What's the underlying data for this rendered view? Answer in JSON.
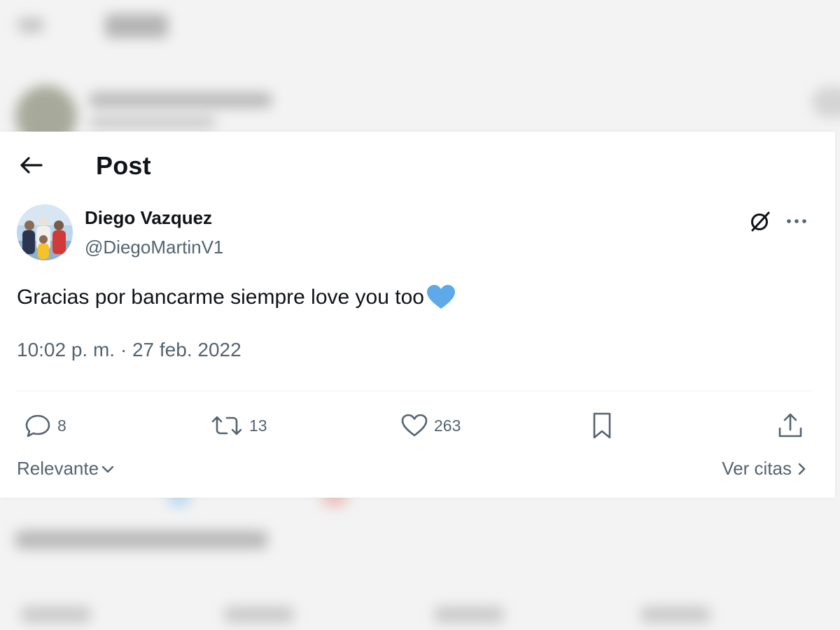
{
  "header": {
    "title": "Post",
    "back_icon": "arrow-left-icon"
  },
  "post": {
    "author": {
      "display_name": "Diego Vazquez",
      "handle": "@DiegoMartinV1"
    },
    "text": "Gracias por bancarme siempre love you too",
    "emoji": "blue-heart-emoji",
    "timestamp": "10:02 p. m. · 27 feb. 2022"
  },
  "actions": {
    "replies": "8",
    "reposts": "13",
    "likes": "263"
  },
  "footer": {
    "sort_label": "Relevante",
    "quotes_label": "Ver citas"
  },
  "colors": {
    "text_primary": "#0f1419",
    "text_secondary": "#536471",
    "emoji_blue": "#5da9e9",
    "divider": "#eff3f4"
  }
}
